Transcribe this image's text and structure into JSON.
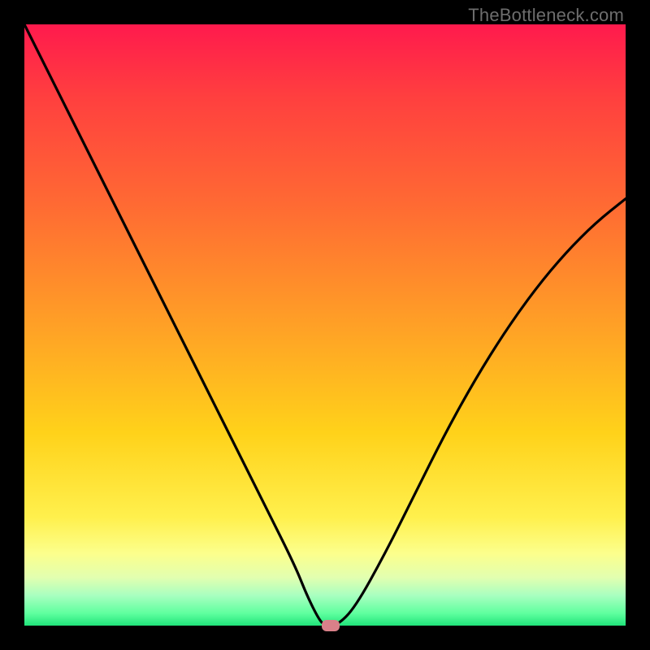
{
  "watermark": "TheBottleneck.com",
  "colors": {
    "frame": "#000000",
    "curve": "#000000",
    "marker": "#d98089",
    "gradient_top": "#ff1a4d",
    "gradient_bottom": "#20e37a"
  },
  "chart_data": {
    "type": "line",
    "title": "",
    "xlabel": "",
    "ylabel": "",
    "xlim": [
      0,
      100
    ],
    "ylim": [
      0,
      100
    ],
    "grid": false,
    "legend": false,
    "annotations": [],
    "series": [
      {
        "name": "bottleneck-curve",
        "x": [
          0,
          5,
          10,
          15,
          20,
          25,
          30,
          35,
          40,
          45,
          47,
          49,
          50,
          52,
          55,
          60,
          65,
          70,
          75,
          80,
          85,
          90,
          95,
          100
        ],
        "values": [
          100,
          90,
          80,
          70,
          60,
          50,
          40,
          30,
          20,
          10,
          5,
          1,
          0,
          0,
          3,
          12,
          22,
          32,
          41,
          49,
          56,
          62,
          67,
          71
        ]
      }
    ],
    "marker": {
      "x": 51,
      "y": 0
    }
  }
}
